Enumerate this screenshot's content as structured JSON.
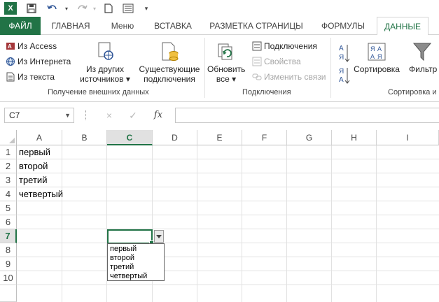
{
  "quick_access": {
    "logo": "X",
    "icons": [
      "save-icon",
      "undo-icon",
      "redo-icon",
      "new-file-icon",
      "form-icon",
      "customize-icon"
    ]
  },
  "tabs": [
    {
      "label": "ФАЙЛ",
      "kind": "file"
    },
    {
      "label": "ГЛАВНАЯ",
      "kind": "normal"
    },
    {
      "label": "Меню",
      "kind": "normal"
    },
    {
      "label": "ВСТАВКА",
      "kind": "normal"
    },
    {
      "label": "РАЗМЕТКА СТРАНИЦЫ",
      "kind": "normal"
    },
    {
      "label": "ФОРМУЛЫ",
      "kind": "normal"
    },
    {
      "label": "ДАННЫЕ",
      "kind": "active"
    }
  ],
  "ribbon": {
    "external": {
      "from_access": "Из Access",
      "from_web": "Из Интернета",
      "from_text": "Из текста",
      "from_other_line1": "Из других",
      "from_other_line2": "источников",
      "existing_line1": "Существующие",
      "existing_line2": "подключения",
      "label": "Получение внешних данных"
    },
    "connections": {
      "refresh_line1": "Обновить",
      "refresh_line2": "все",
      "connections": "Подключения",
      "properties": "Свойства",
      "edit_links": "Изменить связи",
      "label": "Подключения"
    },
    "sort": {
      "sort": "Сортировка",
      "filter": "Фильтр",
      "label": "Сортировка и фил"
    }
  },
  "formula_bar": {
    "name_box": "C7",
    "cancel": "×",
    "enter": "✓",
    "fx": "fx",
    "value": ""
  },
  "columns": [
    "A",
    "B",
    "C",
    "D",
    "E",
    "F",
    "G",
    "H",
    "I"
  ],
  "selected_column": "C",
  "rows": [
    "1",
    "2",
    "3",
    "4",
    "5",
    "6",
    "7",
    "8",
    "9",
    "10"
  ],
  "selected_row": "7",
  "cells_a": [
    "первый",
    "второй",
    "третий",
    "четвертый"
  ],
  "dropdown_items": [
    "первый",
    "второй",
    "третий",
    "четвертый"
  ],
  "colors": {
    "accent": "#217346",
    "header_bg": "#e1e1e1",
    "gridline": "#e1e1e1"
  }
}
